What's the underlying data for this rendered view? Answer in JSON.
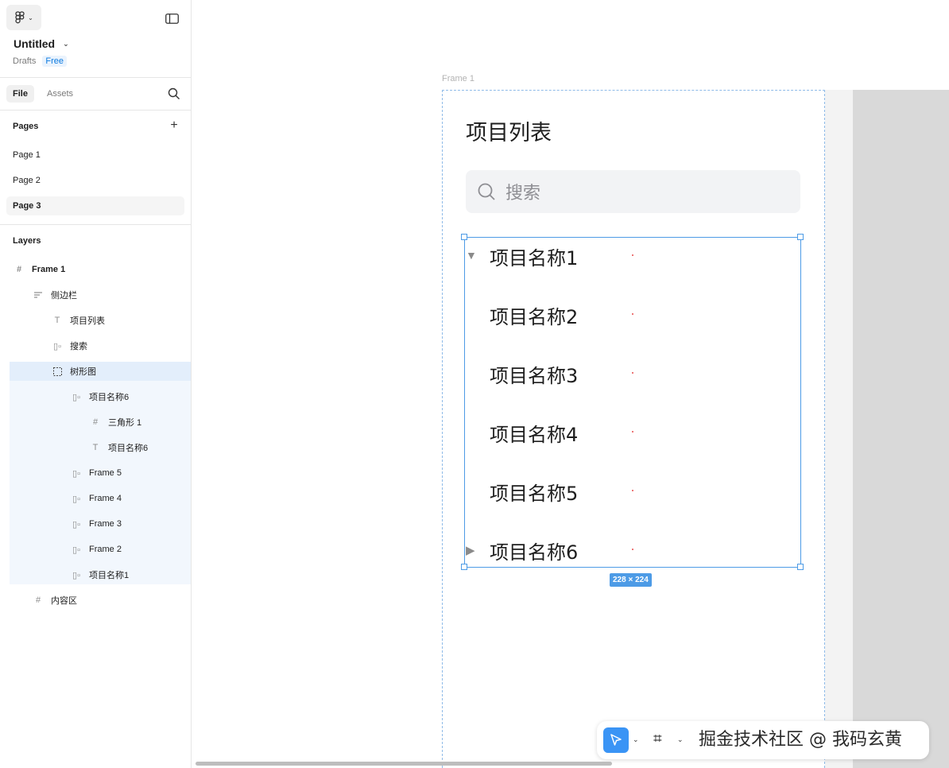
{
  "sidebar": {
    "file_name": "Untitled",
    "drafts_label": "Drafts",
    "plan_badge": "Free",
    "tabs": [
      {
        "label": "File"
      },
      {
        "label": "Assets"
      }
    ],
    "pages_header": "Pages",
    "pages": [
      {
        "label": "Page 1"
      },
      {
        "label": "Page 2"
      },
      {
        "label": "Page 3"
      }
    ],
    "layers_header": "Layers",
    "layers": [
      {
        "label": "Frame 1",
        "icon": "frame-icon"
      },
      {
        "label": "侧边栏",
        "icon": "autolayout-vertical-icon"
      },
      {
        "label": "项目列表",
        "icon": "text-icon"
      },
      {
        "label": "搜索",
        "icon": "autolayout-horizontal-icon"
      },
      {
        "label": "树形图",
        "icon": "section-icon"
      },
      {
        "label": "项目名称6",
        "icon": "autolayout-horizontal-icon"
      },
      {
        "label": "三角形 1",
        "icon": "frame-icon"
      },
      {
        "label": "项目名称6",
        "icon": "text-icon"
      },
      {
        "label": "Frame 5",
        "icon": "autolayout-horizontal-icon"
      },
      {
        "label": "Frame 4",
        "icon": "autolayout-horizontal-icon"
      },
      {
        "label": "Frame 3",
        "icon": "autolayout-horizontal-icon"
      },
      {
        "label": "Frame 2",
        "icon": "autolayout-horizontal-icon"
      },
      {
        "label": "项目名称1",
        "icon": "autolayout-horizontal-icon"
      },
      {
        "label": "内容区",
        "icon": "frame-icon"
      }
    ]
  },
  "canvas": {
    "frame_label": "Frame 1",
    "title": "项目列表",
    "search_placeholder": "搜索",
    "tree_items": [
      {
        "label": "项目名称1",
        "expanded": true
      },
      {
        "label": "项目名称2"
      },
      {
        "label": "项目名称3"
      },
      {
        "label": "项目名称4"
      },
      {
        "label": "项目名称5"
      },
      {
        "label": "项目名称6",
        "expanded": false
      }
    ],
    "selection_size": "228 × 224"
  },
  "toolbar": {
    "tools": [
      {
        "name": "move-tool"
      },
      {
        "name": "frame-tool"
      }
    ]
  },
  "watermark": "掘金技术社区 @ 我码玄黄",
  "colors": {
    "accent": "#4d9be6",
    "tool_active": "#3a94f5",
    "badge_text": "#0d7be0"
  }
}
